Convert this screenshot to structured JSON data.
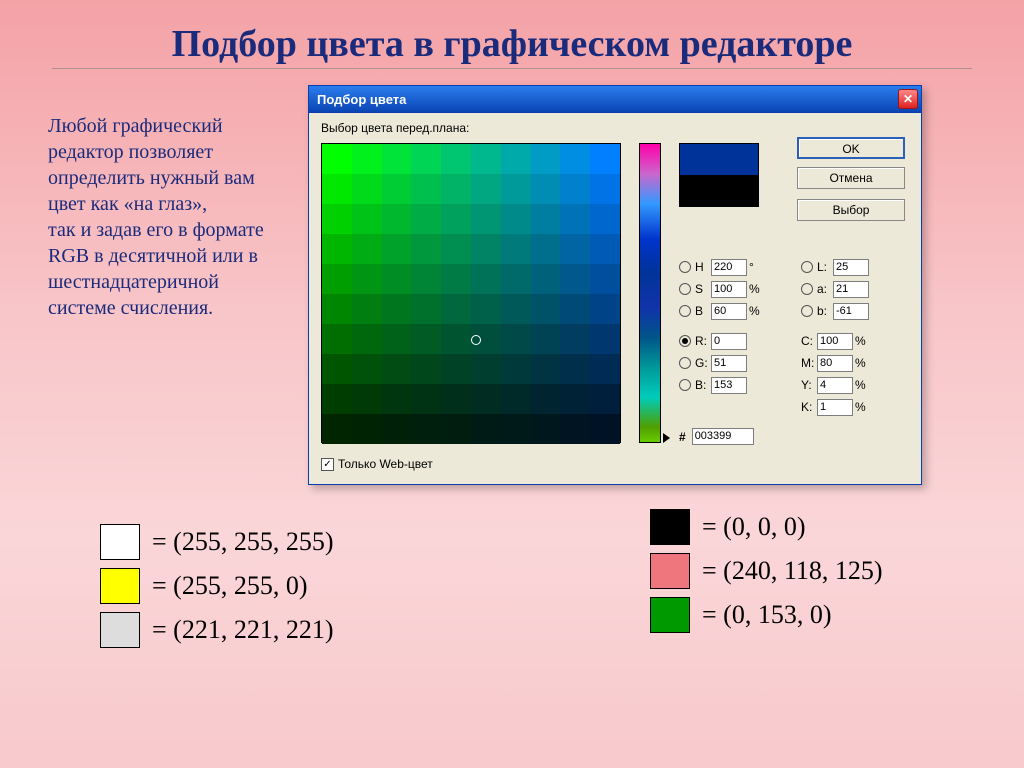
{
  "title": "Подбор цвета в графическом редакторе",
  "side_text": "Любой графический редактор позволяет определить нужный вам цвет как «на глаз»,\nтак и задав его в формате\nRGB в десятичной или в шестнадцатеричной системе счисления.",
  "dialog": {
    "title": "Подбор цвета",
    "prompt": "Выбор цвета перед.плана:",
    "buttons": {
      "ok": "OK",
      "cancel": "Отмена",
      "choose": "Выбор"
    },
    "fields": {
      "H": {
        "label": "H",
        "value": "220",
        "unit": "°"
      },
      "S": {
        "label": "S",
        "value": "100",
        "unit": "%"
      },
      "Bv": {
        "label": "B",
        "value": "60",
        "unit": "%"
      },
      "L": {
        "label": "L:",
        "value": "25"
      },
      "a": {
        "label": "a:",
        "value": "21"
      },
      "b": {
        "label": "b:",
        "value": "-61"
      },
      "R": {
        "label": "R:",
        "value": "0"
      },
      "G": {
        "label": "G:",
        "value": "51"
      },
      "Bc": {
        "label": "B:",
        "value": "153"
      },
      "C": {
        "label": "C:",
        "value": "100",
        "unit": "%"
      },
      "M": {
        "label": "M:",
        "value": "80",
        "unit": "%"
      },
      "Y": {
        "label": "Y:",
        "value": "4",
        "unit": "%"
      },
      "K": {
        "label": "K:",
        "value": "1",
        "unit": "%"
      },
      "hash": {
        "label": "#",
        "value": "003399"
      }
    },
    "web_only": "Только Web-цвет",
    "checkmark": "✓"
  },
  "examples_left": [
    {
      "color": "#ffffff",
      "text": "= (255, 255, 255)"
    },
    {
      "color": "#ffff00",
      "text": "= (255, 255, 0)"
    },
    {
      "color": "#dddddd",
      "text": "= (221, 221, 221)"
    }
  ],
  "examples_right": [
    {
      "color": "#000000",
      "text": "= (0, 0, 0)"
    },
    {
      "color": "#f0767d",
      "text": "= (240, 118, 125)"
    },
    {
      "color": "#009900",
      "text": "= (0, 153, 0)"
    }
  ]
}
